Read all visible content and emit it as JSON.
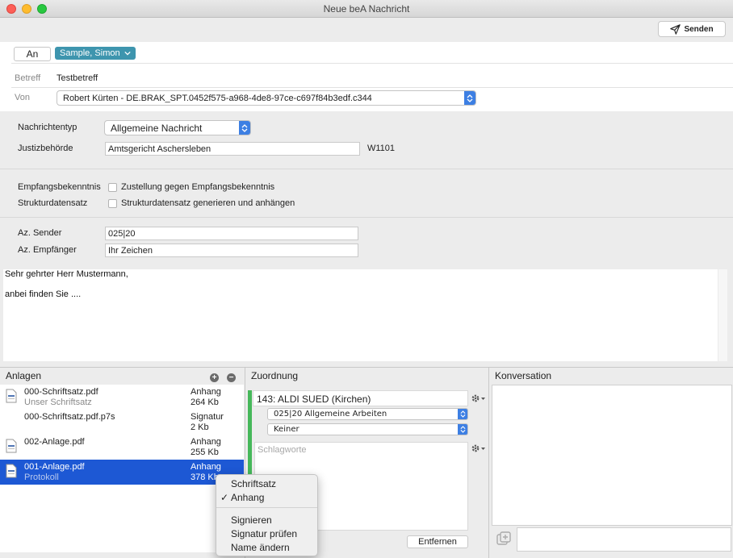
{
  "window": {
    "title": "Neue beA Nachricht"
  },
  "toolbar": {
    "send_label": "Senden"
  },
  "recipients": {
    "an_label": "An",
    "chip_label": "Sample, Simon"
  },
  "betreff": {
    "label": "Betreff",
    "value": "Testbetreff"
  },
  "von": {
    "label": "Von",
    "value": "Robert Kürten - DE.BRAK_SPT.0452f575-a968-4de8-97ce-c697f84b3edf.c344"
  },
  "nachrichtentyp": {
    "label": "Nachrichtentyp",
    "value": "Allgemeine Nachricht"
  },
  "justiz": {
    "label": "Justizbehörde",
    "value": "Amtsgericht Aschersleben",
    "code": "W1101"
  },
  "empfang": {
    "label": "Empfangsbekenntnis",
    "checkbox_label": "Zustellung gegen Empfangsbekenntnis"
  },
  "struktur": {
    "label": "Strukturdatensatz",
    "checkbox_label": "Strukturdatensatz generieren und anhängen"
  },
  "az": {
    "sender_label": "Az. Sender",
    "sender_value": "025|20",
    "empf_label": "Az. Empfänger",
    "empf_value": "Ihr Zeichen"
  },
  "body": {
    "line1": "Sehr gehrter Herr Mustermann,",
    "line2": "anbei finden Sie ...."
  },
  "anlagen": {
    "header": "Anlagen",
    "items": [
      {
        "name": "000-Schriftsatz.pdf",
        "sub": "Unser Schriftsatz",
        "kind": "Anhang",
        "size": "264 Kb"
      },
      {
        "name": "000-Schriftsatz.pdf.p7s",
        "sub": "",
        "kind": "Signatur",
        "size": "2 Kb"
      },
      {
        "name": "002-Anlage.pdf",
        "sub": "",
        "kind": "Anhang",
        "size": "255 Kb"
      },
      {
        "name": "001-Anlage.pdf",
        "sub": "Protokoll",
        "kind": "Anhang",
        "size": "378 Kb"
      }
    ]
  },
  "zuordnung": {
    "header": "Zuordnung",
    "company": "143: ALDI SUED (Kirchen)",
    "project": "025|20 Allgemeine Arbeiten",
    "sub": "Keiner",
    "keywords_placeholder": "Schlagworte",
    "remove_label": "Entfernen"
  },
  "konversation": {
    "header": "Konversation"
  },
  "context_menu": {
    "items": [
      "Schriftsatz",
      "Anhang",
      "Signieren",
      "Signatur prüfen",
      "Name ändern"
    ],
    "checked_mark": "✓"
  },
  "colors": {
    "accent": "#3d7fe3",
    "chip": "#3e95ae",
    "selection": "#1d58d4",
    "assign_bar": "#46b85a"
  }
}
